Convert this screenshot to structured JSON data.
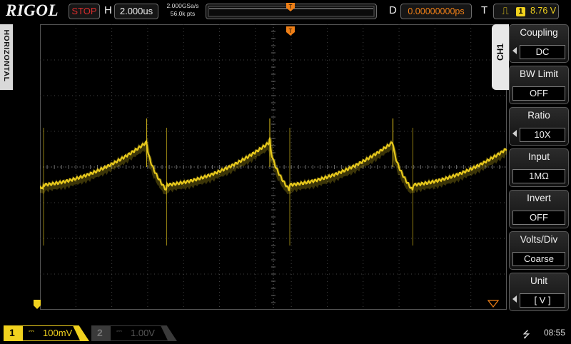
{
  "brand": "RIGOL",
  "run_state": "STOP",
  "horizontal": {
    "label": "H",
    "timebase": "2.000us"
  },
  "acquisition": {
    "sample_rate": "2.000GSa/s",
    "memory_depth": "56.0k pts"
  },
  "delay": {
    "label": "D",
    "value": "0.00000000ps"
  },
  "trigger": {
    "label": "T",
    "edge_icon": "rising-edge-icon",
    "source": "1",
    "level": "8.76 V"
  },
  "side_tab": "HORIZONTAL",
  "menu": {
    "channel_tab": "CH1",
    "items": [
      {
        "title": "Coupling",
        "value": "DC",
        "has_arrow": true
      },
      {
        "title": "BW Limit",
        "value": "OFF",
        "has_arrow": false
      },
      {
        "title": "Ratio",
        "value": "10X",
        "has_arrow": true
      },
      {
        "title": "Input",
        "value": "1MΩ",
        "has_arrow": false
      },
      {
        "title": "Invert",
        "value": "OFF",
        "has_arrow": false
      },
      {
        "title": "Volts/Div",
        "value": "Coarse",
        "has_arrow": false
      },
      {
        "title": "Unit",
        "value": "[ V ]",
        "has_arrow": true
      }
    ]
  },
  "channels": [
    {
      "number": "1",
      "coupling_icon": "dc-coupling-icon",
      "scale": "100mV",
      "active": true
    },
    {
      "number": "2",
      "coupling_icon": "dc-coupling-icon",
      "scale": "1.00V",
      "active": false
    }
  ],
  "status": {
    "usb_icon": "usb-icon",
    "time": "08:55"
  },
  "colors": {
    "ch1": "#f1d21e",
    "trigger_marker": "#ef7f16",
    "stop": "#d62d2d"
  }
}
